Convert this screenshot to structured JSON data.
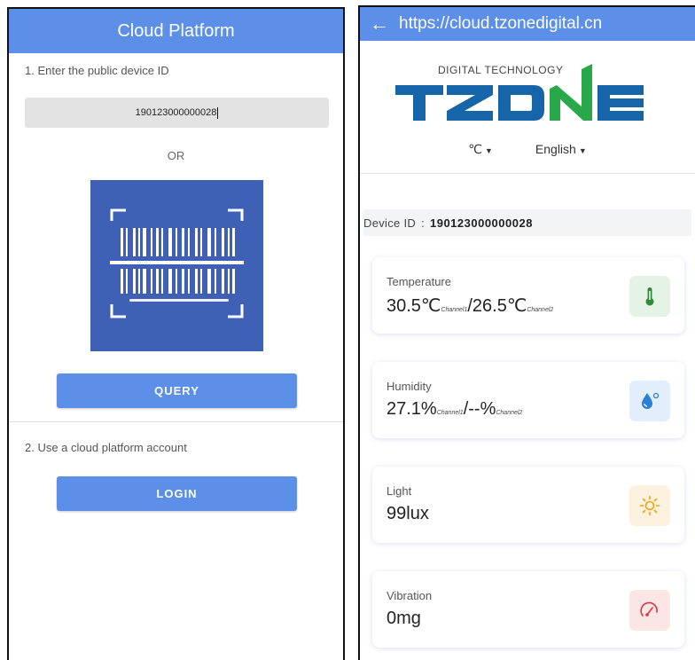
{
  "left": {
    "header_title": "Cloud Platform",
    "step1_label": "1. Enter the public device ID",
    "device_id_value": "190123000000028",
    "or_label": "OR",
    "scan_icon": "barcode-scan-icon",
    "query_button": "QUERY",
    "step2_label": "2. Use a cloud platform account",
    "login_button": "LOGIN",
    "accent_color": "#5b8fe8",
    "scan_bg_color": "#3e61b5"
  },
  "right": {
    "url": "https://cloud.tzonedigital.cn",
    "back_icon": "back-arrow-icon",
    "logo": {
      "tagline": "DIGITAL TECHNOLOGY",
      "brand": "TZONE"
    },
    "unit_selector": "℃",
    "language_selector": "English",
    "device_label": "Device ID",
    "device_sep": ":",
    "device_id": "190123000000028",
    "cards": {
      "temperature": {
        "label": "Temperature",
        "v1": "30.5℃",
        "c1": "Channel1",
        "sep": "/",
        "v2": "26.5℃",
        "c2": "Channel2",
        "icon": "thermometer-icon",
        "icon_bg": "#e4f3e6",
        "icon_color": "#2e8b3a"
      },
      "humidity": {
        "label": "Humidity",
        "v1": "27.1%",
        "c1": "Channel1",
        "sep": "/",
        "v2": "--%",
        "c2": "Channel2",
        "icon": "water-drop-icon",
        "icon_bg": "#e3eefc",
        "icon_color": "#2b7fd8"
      },
      "light": {
        "label": "Light",
        "value": "99lux",
        "icon": "sun-icon",
        "icon_bg": "#fdf2df",
        "icon_color": "#f2a20c"
      },
      "vibration": {
        "label": "Vibration",
        "value": "0mg",
        "icon": "gauge-icon",
        "icon_bg": "#fbe5e5",
        "icon_color": "#d9363e"
      }
    }
  }
}
